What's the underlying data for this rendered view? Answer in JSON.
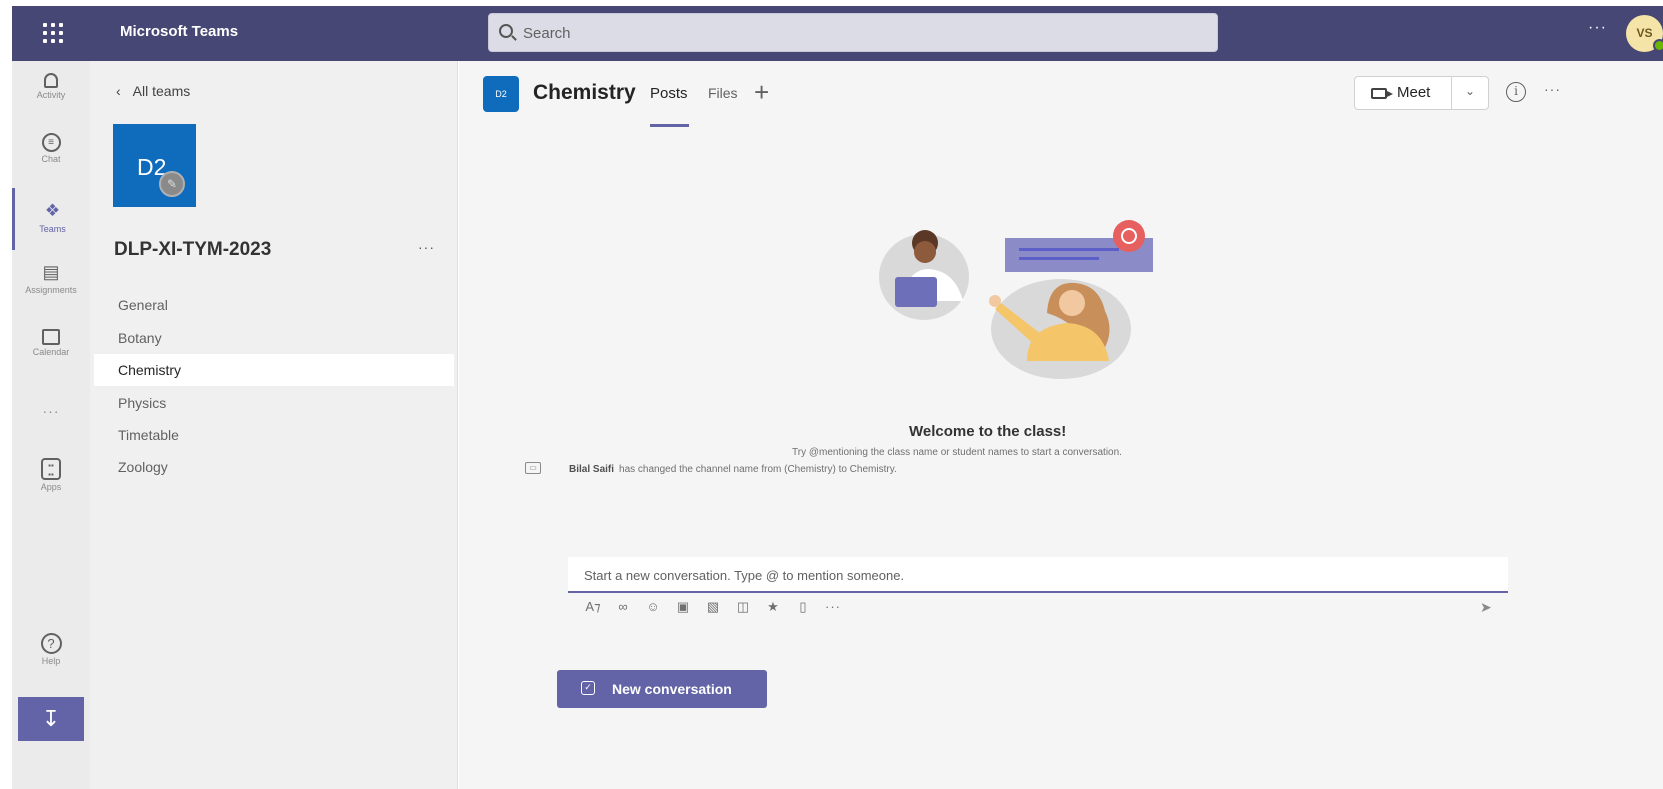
{
  "header": {
    "app_title": "Microsoft Teams",
    "search_placeholder": "Search",
    "more_label": "···",
    "avatar_initials": "VS"
  },
  "rail": {
    "items": [
      {
        "label": "Activity",
        "icon": "bell-icon"
      },
      {
        "label": "Chat",
        "icon": "chat-icon"
      },
      {
        "label": "Teams",
        "icon": "teams-icon"
      },
      {
        "label": "Assignments",
        "icon": "assignments-icon"
      },
      {
        "label": "Calendar",
        "icon": "calendar-icon"
      },
      {
        "label": "···",
        "icon": "more-icon"
      },
      {
        "label": "Apps",
        "icon": "apps-icon"
      },
      {
        "label": "Help",
        "icon": "help-icon"
      }
    ],
    "active": "Teams"
  },
  "team": {
    "back_label": "All teams",
    "tile_initials": "D2",
    "name": "DLP-XI-TYM-2023",
    "more_label": "···",
    "channels": [
      "General",
      "Botany",
      "Chemistry",
      "Physics",
      "Timetable",
      "Zoology"
    ],
    "active_channel": "Chemistry"
  },
  "channel": {
    "avatar_text": "D2",
    "title": "Chemistry",
    "tabs": [
      "Posts",
      "Files"
    ],
    "active_tab": "Posts",
    "meet_label": "Meet",
    "more_label": "···"
  },
  "content": {
    "welcome_title": "Welcome to the class!",
    "welcome_subtitle": "Try @mentioning the class name or student names to start a conversation.",
    "system_message_user": "Bilal Saifi",
    "system_message_text": "has changed the channel name from (Chemistry) to Chemistry.",
    "composer_placeholder": "Start a new conversation. Type @ to mention someone.",
    "new_conversation_label": "New conversation"
  },
  "colors": {
    "topbar": "#464775",
    "accent": "#6264a7",
    "team_tile": "#0f6cbd"
  }
}
